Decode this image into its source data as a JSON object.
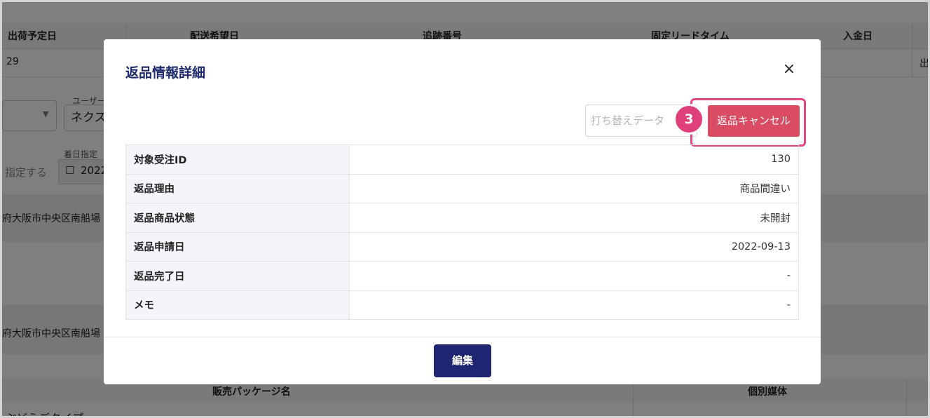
{
  "background": {
    "table1_headers": [
      "出荷予定日",
      "配送希望日",
      "追跡番号",
      "固定リードタイム",
      "入金日"
    ],
    "table1_row": [
      "29",
      "出"
    ],
    "user_label": "ユーザー",
    "user_value": "ネクス",
    "arrival_label": "着日指定",
    "arrival_value": "2022",
    "specify_text": "指定する",
    "address_1": "府大阪市中央区南船場",
    "address_2": "府大阪市中央区南船場",
    "table2_headers": [
      "販売パッケージ名",
      "個別媒体"
    ],
    "table2_row": "ぶどうごタイプ"
  },
  "modal": {
    "title": "返品情報詳細",
    "close_label": "×",
    "reprint_placeholder": "打ち替えデータ",
    "step_number": "3",
    "cancel_label": "返品キャンセル",
    "rows": [
      {
        "label": "対象受注ID",
        "value": "130"
      },
      {
        "label": "返品理由",
        "value": "商品間違い"
      },
      {
        "label": "返品商品状態",
        "value": "未開封"
      },
      {
        "label": "返品申請日",
        "value": "2022-09-13"
      },
      {
        "label": "返品完了日",
        "value": "-"
      },
      {
        "label": "メモ",
        "value": "-"
      }
    ],
    "edit_label": "編集"
  },
  "colors": {
    "title": "#1e2a6e",
    "cancel_button": "#d94c63",
    "highlight": "#e0467f",
    "edit_button": "#1f2570"
  }
}
